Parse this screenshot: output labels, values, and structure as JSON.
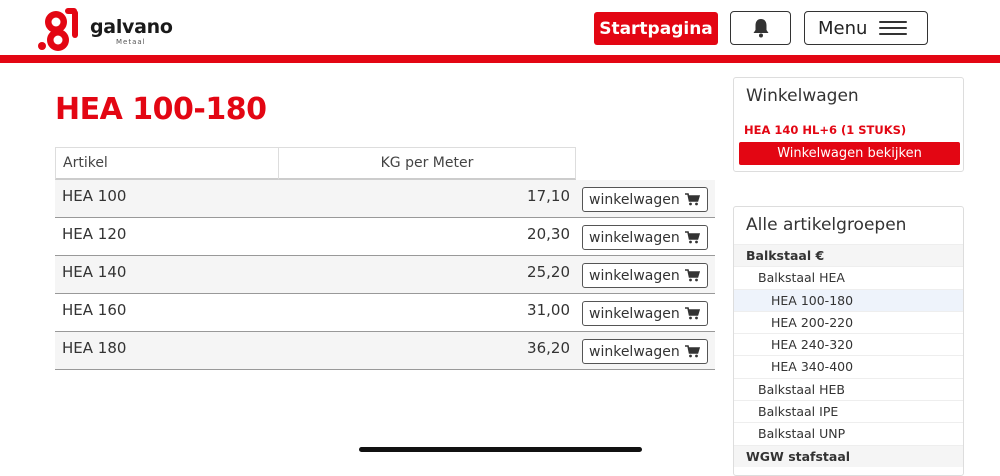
{
  "header": {
    "logo_text": "galvano",
    "logo_subtext": "Metaal",
    "start_label": "Startpagina",
    "bell_icon": "bell-icon",
    "menu_label": "Menu",
    "menu_icon": "hamburger-icon",
    "brand_color": "#e30613"
  },
  "main": {
    "title": "HEA 100-180",
    "columns": [
      "Artikel",
      "KG per Meter",
      ""
    ],
    "rows": [
      {
        "name": "HEA 100",
        "kg": "17,10",
        "cart_label": "winkelwagen"
      },
      {
        "name": "HEA 120",
        "kg": "20,30",
        "cart_label": "winkelwagen"
      },
      {
        "name": "HEA 140",
        "kg": "25,20",
        "cart_label": "winkelwagen"
      },
      {
        "name": "HEA 160",
        "kg": "31,00",
        "cart_label": "winkelwagen"
      },
      {
        "name": "HEA 180",
        "kg": "36,20",
        "cart_label": "winkelwagen"
      }
    ]
  },
  "cart": {
    "title": "Winkelwagen",
    "item": "HEA 140 HL+6 (1 STUKS)",
    "view_label": "Winkelwagen bekijken"
  },
  "groups": {
    "title": "Alle artikelgroepen",
    "items": [
      {
        "label": "Balkstaal €",
        "level": 0
      },
      {
        "label": "Balkstaal HEA",
        "level": 1
      },
      {
        "label": "HEA 100-180",
        "level": 2,
        "active": true
      },
      {
        "label": "HEA 200-220",
        "level": 2
      },
      {
        "label": "HEA 240-320",
        "level": 2
      },
      {
        "label": "HEA 340-400",
        "level": 2
      },
      {
        "label": "Balkstaal HEB",
        "level": 1
      },
      {
        "label": "Balkstaal IPE",
        "level": 1
      },
      {
        "label": "Balkstaal UNP",
        "level": 1
      },
      {
        "label": "WGW stafstaal",
        "level": 0
      }
    ]
  }
}
